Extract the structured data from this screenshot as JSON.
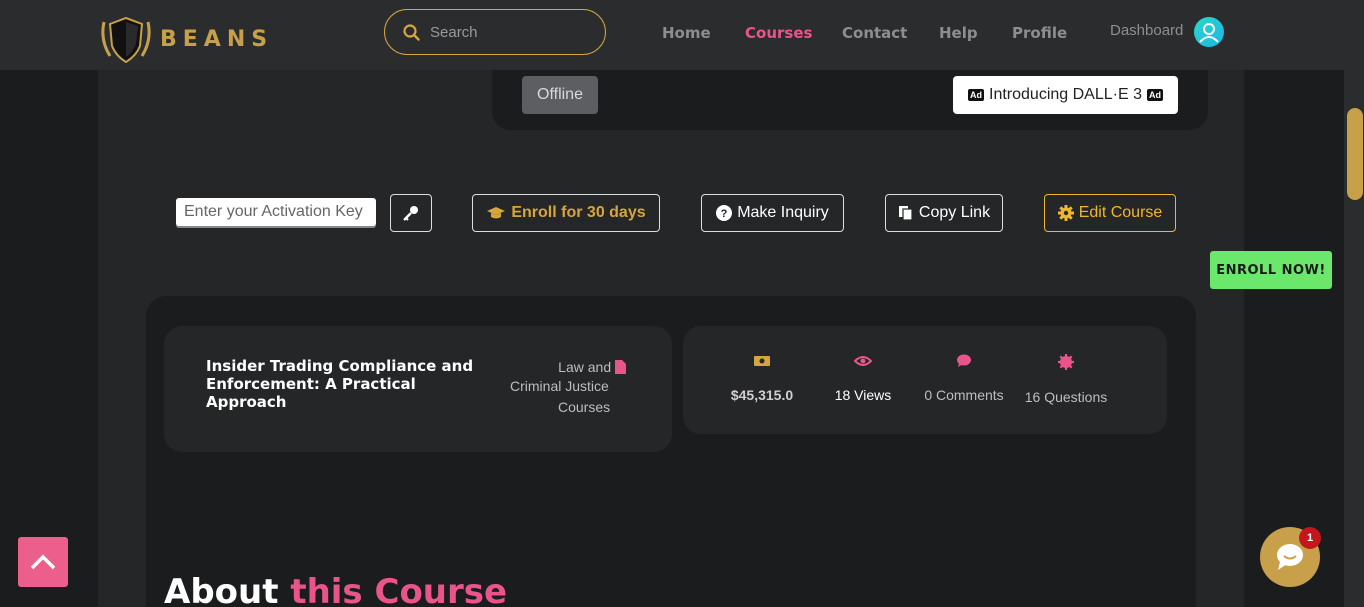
{
  "brand": {
    "name": "BEANS"
  },
  "search": {
    "placeholder": "Search"
  },
  "nav": {
    "links": [
      {
        "label": "Home"
      },
      {
        "label": "Courses",
        "active": true
      },
      {
        "label": "Contact"
      },
      {
        "label": "Help"
      },
      {
        "label": "Profile"
      }
    ],
    "dashboard": "Dashboard"
  },
  "status": {
    "offline": "Offline"
  },
  "ad": {
    "text": "Introducing DALL·E 3",
    "tag": "Ad"
  },
  "actions": {
    "activation_placeholder": "Enter your Activation Key",
    "enroll": "Enroll for 30 days",
    "inquiry": "Make Inquiry",
    "copy": "Copy Link",
    "edit": "Edit Course"
  },
  "floating": {
    "enroll_now": "ENROLL NOW!",
    "chat_badge": "1"
  },
  "course": {
    "title": "Insider Trading Compliance and Enforcement: A Practical Approach",
    "category_line1": "Law and",
    "category_line2": "Criminal Justice",
    "category_line3": "Courses"
  },
  "stats": {
    "price": "$45,315.0",
    "views": "18 Views",
    "comments": "0 Comments",
    "questions": "16 Questions"
  },
  "about": {
    "prefix": "About",
    "highlight": "this Course"
  },
  "colors": {
    "accent_gold": "#d6a53c",
    "accent_pink": "#e9558a",
    "enroll_green": "#6be86b"
  }
}
